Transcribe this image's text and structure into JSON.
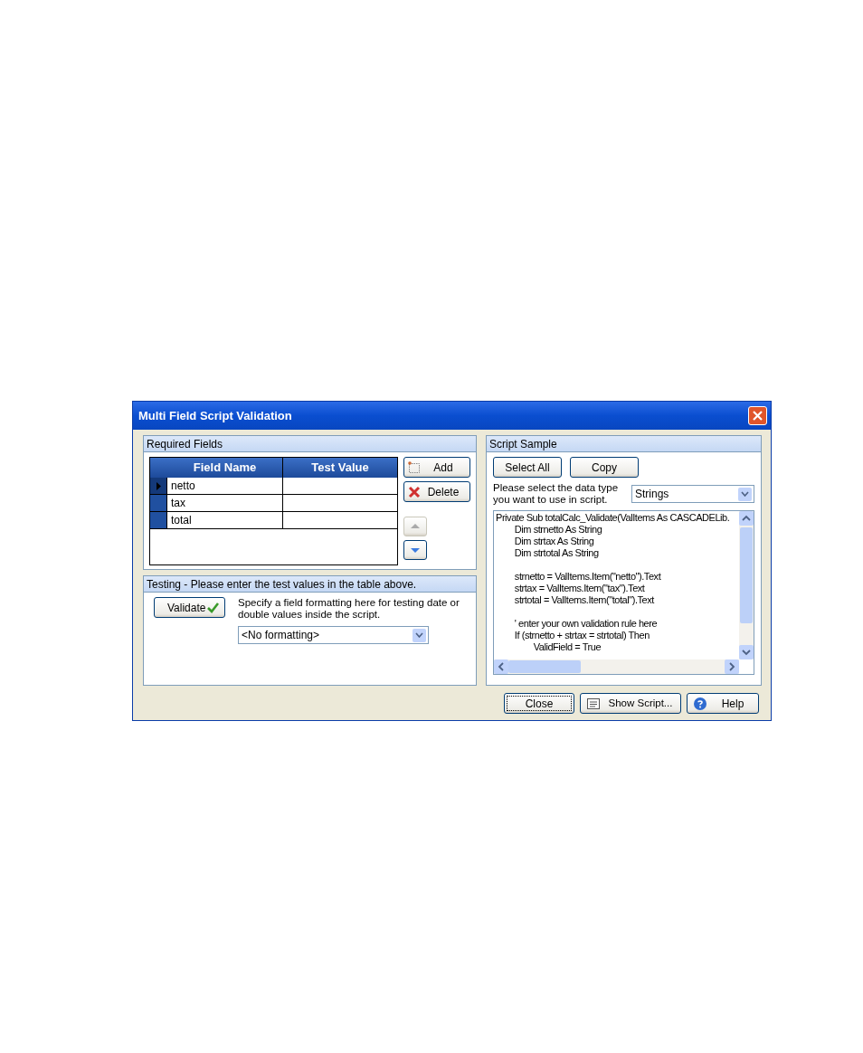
{
  "window": {
    "title": "Multi Field Script Validation"
  },
  "required_fields": {
    "title": "Required Fields",
    "columns": [
      "Field Name",
      "Test Value"
    ],
    "rows": [
      {
        "field_name": "netto",
        "selected": true
      },
      {
        "field_name": "tax",
        "selected": false
      },
      {
        "field_name": "total",
        "selected": false
      }
    ],
    "buttons": [
      {
        "label": "Add",
        "kind": "add"
      },
      {
        "label": "Delete",
        "kind": "delete"
      }
    ],
    "move_up": {
      "disabled": true
    },
    "move_down": {
      "disabled": false
    }
  },
  "testing": {
    "title": "Testing - Please enter the test values in the table above.",
    "validate_button": "Validate",
    "hint": "Specify a field formatting here for testing date or double values inside the script.",
    "formatting": "<No formatting>"
  },
  "script_sample": {
    "title": "Script Sample",
    "buttons": [
      "Select All",
      "Copy"
    ],
    "data_type_label": "Please select the data type you want to use in script.",
    "data_type": "Strings",
    "code_blocks": [
      {
        "lines": [
          "Private Sub totalCalc_Validate(ValItems As CASCADELib.",
          "\tDim strnetto As String",
          "\tDim strtax As String",
          "\tDim strtotal As String"
        ]
      },
      {
        "lines": [
          "\tstrnetto = ValItems.Item(\"netto\").Text",
          "\tstrtax = ValItems.Item(\"tax\").Text",
          "\tstrtotal = ValItems.Item(\"total\").Text"
        ]
      },
      {
        "lines": [
          "\t' enter your own validation rule here",
          "\tIf (strnetto + strtax = strtotal) Then",
          "\t\tValidField = True"
        ]
      }
    ]
  },
  "footer_buttons": [
    {
      "label": "Close",
      "kind": "close"
    },
    {
      "label": "Show Script...",
      "kind": "script"
    },
    {
      "label": "Help",
      "kind": "help"
    }
  ]
}
